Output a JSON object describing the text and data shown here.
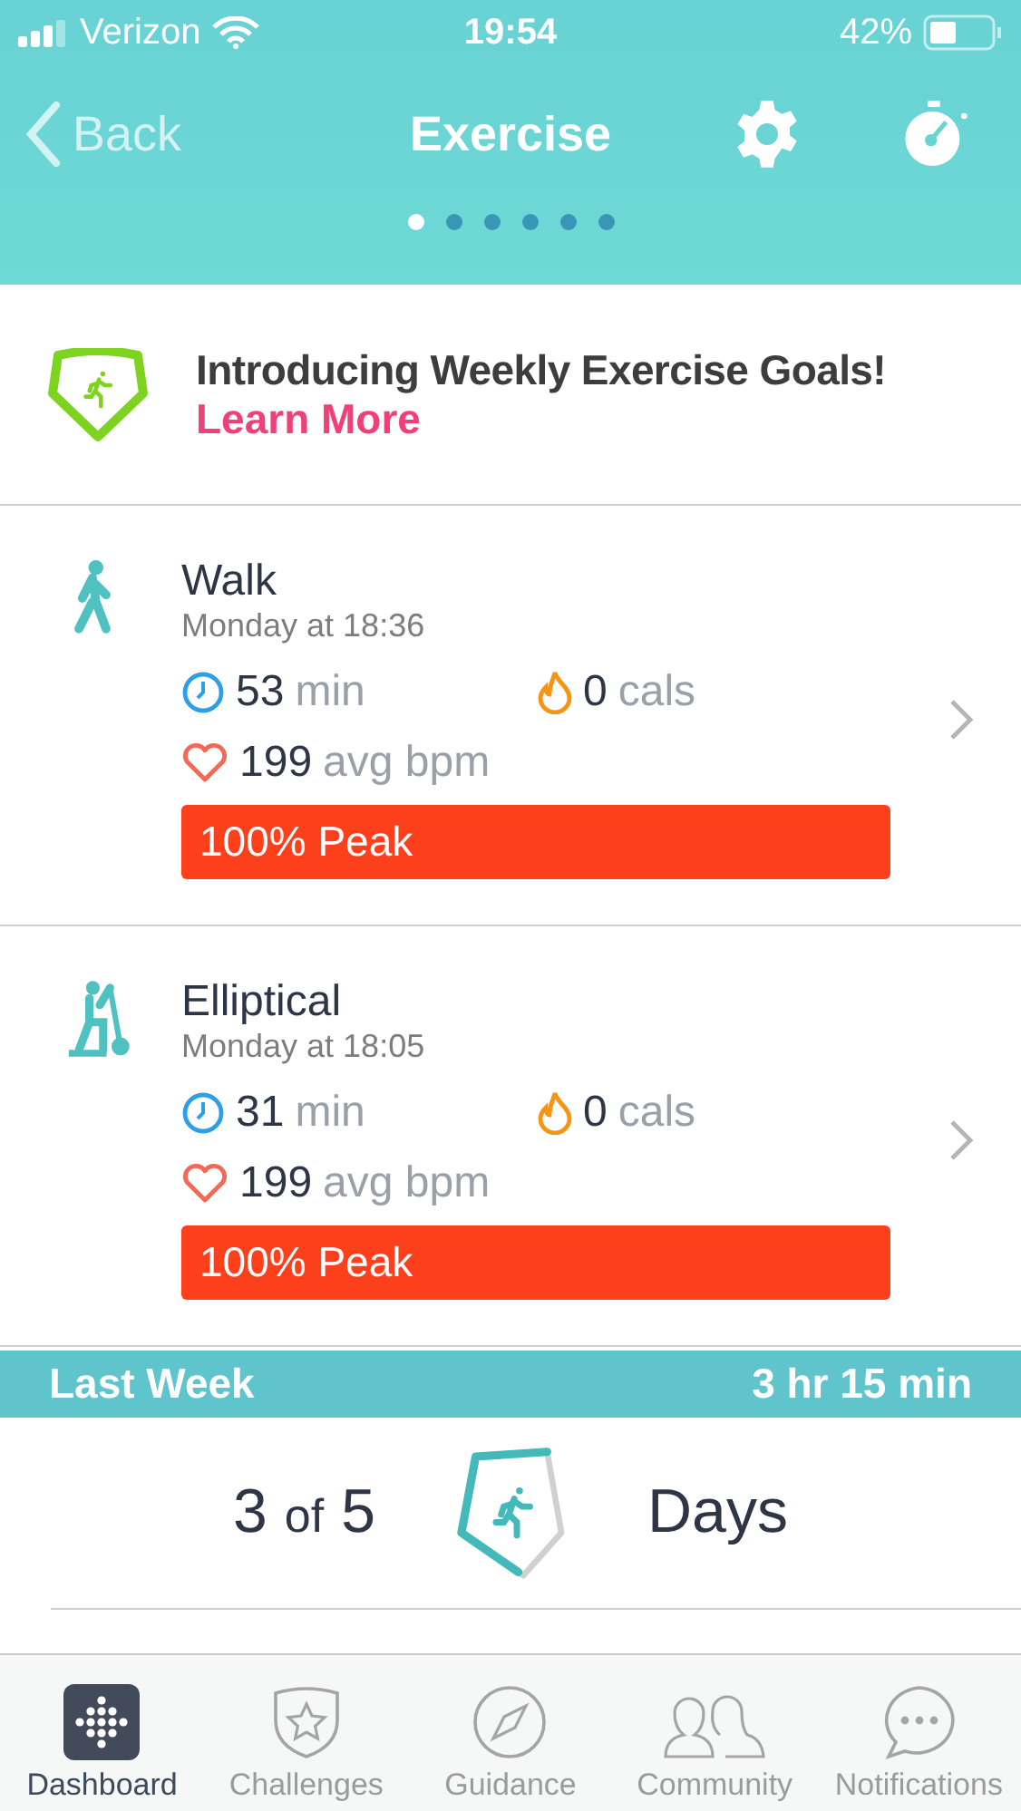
{
  "status_bar": {
    "carrier": "Verizon",
    "time": "19:54",
    "battery": "42%"
  },
  "nav": {
    "back": "Back",
    "title": "Exercise"
  },
  "page_dots": [
    {
      "selected": true
    },
    {
      "selected": false
    },
    {
      "selected": false
    },
    {
      "selected": false
    },
    {
      "selected": false
    },
    {
      "selected": false
    }
  ],
  "banner": {
    "title": "Introducing Weekly Exercise Goals!",
    "link": "Learn More"
  },
  "exercises": [
    {
      "kind": "walk",
      "name": "Walk",
      "when": "Monday at 18:36",
      "duration": "53",
      "duration_unit": "min",
      "calories": "0",
      "calories_unit": "cals",
      "heart_rate": "199",
      "heart_rate_unit": "avg bpm",
      "zone": "100% Peak"
    },
    {
      "kind": "elliptical",
      "name": "Elliptical",
      "when": "Monday at 18:05",
      "duration": "31",
      "duration_unit": "min",
      "calories": "0",
      "calories_unit": "cals",
      "heart_rate": "199",
      "heart_rate_unit": "avg bpm",
      "zone": "100% Peak"
    }
  ],
  "last_week": {
    "label": "Last Week",
    "total": "3 hr 15 min",
    "done": "3",
    "of": "of",
    "goal": "5",
    "unit": "Days"
  },
  "tab_bar": [
    {
      "label": "Dashboard",
      "selected": true
    },
    {
      "label": "Challenges",
      "selected": false
    },
    {
      "label": "Guidance",
      "selected": false
    },
    {
      "label": "Community",
      "selected": false
    },
    {
      "label": "Notifications",
      "selected": false
    }
  ]
}
